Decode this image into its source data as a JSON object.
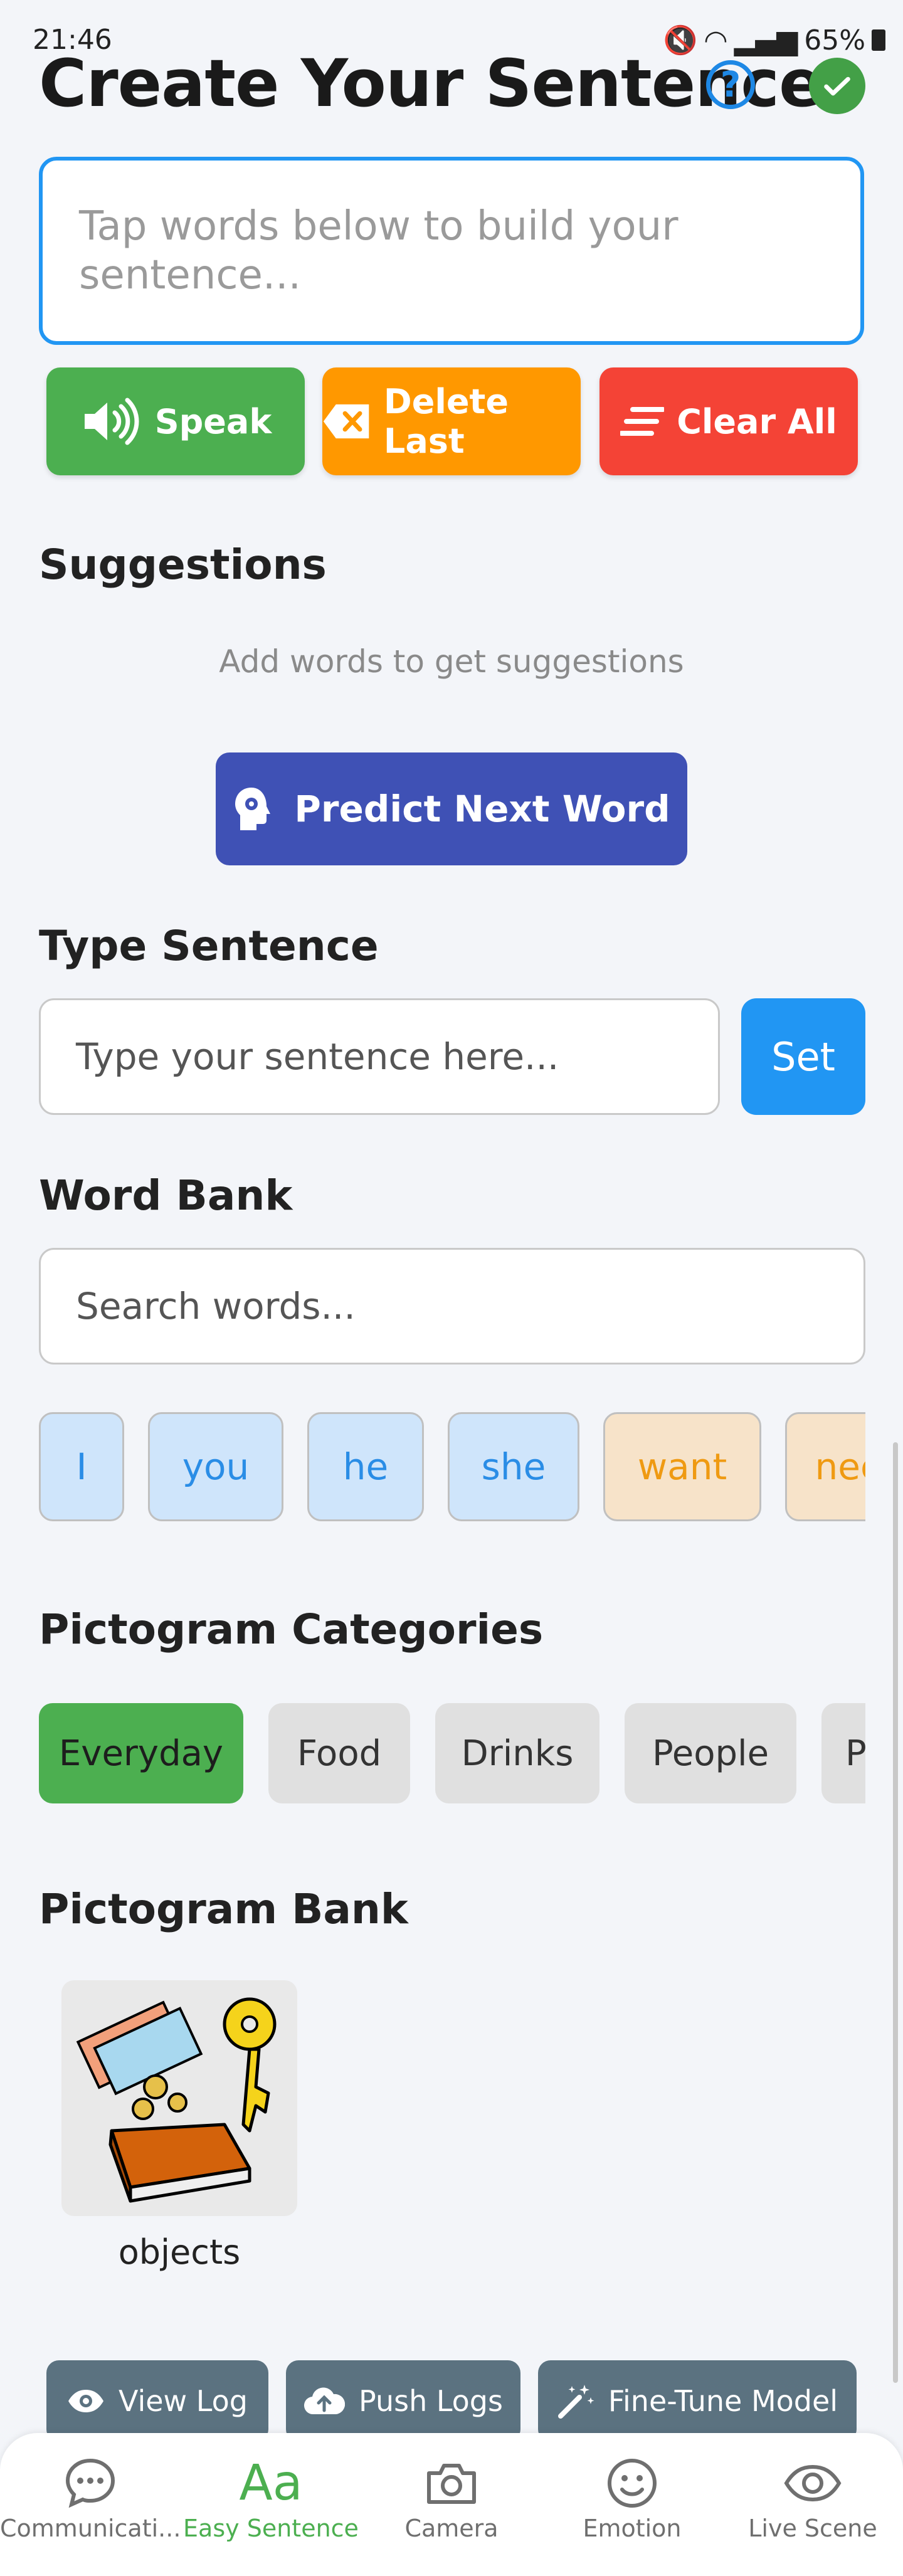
{
  "status": {
    "time": "21:46",
    "battery": "65%"
  },
  "header": {
    "title": "Create Your Sentence"
  },
  "sentence": {
    "placeholder": "Tap words below to build your sentence..."
  },
  "actions": {
    "speak": "Speak",
    "delete_last": "Delete Last",
    "clear_all": "Clear All"
  },
  "suggestions": {
    "title": "Suggestions",
    "hint": "Add words to get suggestions",
    "predict_label": "Predict Next Word"
  },
  "type_sentence": {
    "title": "Type Sentence",
    "placeholder": "Type your sentence here...",
    "set_label": "Set"
  },
  "word_bank": {
    "title": "Word Bank",
    "search_placeholder": "Search words...",
    "words": [
      {
        "text": "I",
        "kind": "pron"
      },
      {
        "text": "you",
        "kind": "pron"
      },
      {
        "text": "he",
        "kind": "pron"
      },
      {
        "text": "she",
        "kind": "pron"
      },
      {
        "text": "want",
        "kind": "verb"
      },
      {
        "text": "need",
        "kind": "verb"
      }
    ]
  },
  "categories": {
    "title": "Pictogram Categories",
    "items": [
      "Everyday",
      "Food",
      "Drinks",
      "People",
      "Places"
    ],
    "active": "Everyday"
  },
  "pictogram_bank": {
    "title": "Pictogram Bank",
    "items": [
      {
        "label": "objects"
      }
    ]
  },
  "tools": {
    "view_log": "View Log",
    "push_logs": "Push Logs",
    "fine_tune": "Fine-Tune Model"
  },
  "nav": {
    "items": [
      "Communicati...",
      "Easy Sentence",
      "Camera",
      "Emotion",
      "Live Scene"
    ],
    "active": "Easy Sentence"
  },
  "colors": {
    "accent_blue": "#2196f3",
    "speak_green": "#4caf50",
    "delete_orange": "#ff9800",
    "clear_red": "#f44336",
    "predict_indigo": "#3f51b5",
    "tool_slate": "#5b7280"
  }
}
